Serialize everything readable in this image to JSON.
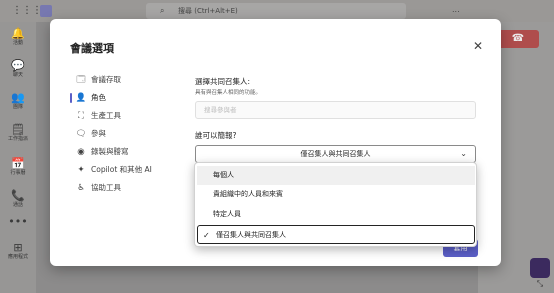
{
  "app": {
    "search_placeholder": "搜尋 (Ctrl+Alt+E)",
    "more_label": "...",
    "hangup_icon": "phone-hangup-icon",
    "rail": [
      {
        "label": "活動",
        "icon": "bell-icon",
        "glyph": "🔔"
      },
      {
        "label": "聊天",
        "icon": "chat-icon",
        "glyph": "💬"
      },
      {
        "label": "團隊",
        "icon": "teams-icon",
        "glyph": "👥"
      },
      {
        "label": "工作指派",
        "icon": "assignments-icon",
        "glyph": "🗒"
      },
      {
        "label": "行事曆",
        "icon": "calendar-icon",
        "glyph": "📅"
      },
      {
        "label": "通話",
        "icon": "phone-icon",
        "glyph": "📞"
      },
      {
        "label": "",
        "icon": "more-icon",
        "glyph": "•••"
      },
      {
        "label": "應用程式",
        "icon": "apps-icon",
        "glyph": "⊞"
      }
    ]
  },
  "dialog": {
    "title": "會議選項",
    "close_icon": "close-icon",
    "nav": [
      {
        "label": "會議存取",
        "icon": "access-icon",
        "glyph": "🗔"
      },
      {
        "label": "角色",
        "icon": "person-icon",
        "glyph": "👤",
        "active": true
      },
      {
        "label": "生產工具",
        "icon": "productivity-icon",
        "glyph": "⛶"
      },
      {
        "label": "參與",
        "icon": "chat-bubble-icon",
        "glyph": "🗨"
      },
      {
        "label": "錄製與謄寫",
        "icon": "record-icon",
        "glyph": "◉"
      },
      {
        "label": "Copilot 和其他 AI",
        "icon": "copilot-icon",
        "glyph": "✦"
      },
      {
        "label": "協助工具",
        "icon": "accessibility-icon",
        "glyph": "♿"
      }
    ],
    "cohost": {
      "label": "選擇共同召集人:",
      "sub": "具有與召集人相同的功能。",
      "placeholder": "搜尋參與者"
    },
    "presenter": {
      "label": "誰可以簡報?",
      "value": "僅召集人與共同召集人"
    },
    "apply_label": "套用"
  },
  "listbox": {
    "options": [
      {
        "label": "每個人",
        "hover": true,
        "selected": false
      },
      {
        "label": "貴組織中的人員和來賓",
        "hover": false,
        "selected": false
      },
      {
        "label": "特定人員",
        "hover": false,
        "selected": false
      },
      {
        "label": "僅召集人與共同召集人",
        "hover": false,
        "selected": true
      }
    ],
    "check_glyph": "✓"
  },
  "colors": {
    "accent": "#5b5fc7",
    "hangup": "#b53a3a"
  }
}
